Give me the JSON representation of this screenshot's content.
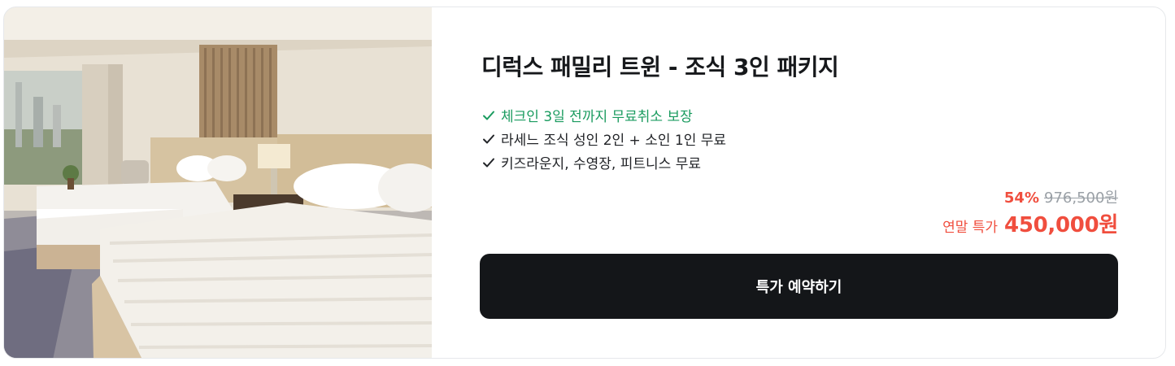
{
  "product": {
    "title": "디럭스 패밀리 트윈 - 조식 3인 패키지",
    "features": [
      {
        "text": "체크인 3일 전까지 무료취소 보장",
        "highlight": true
      },
      {
        "text": "라세느 조식 성인 2인 + 소인 1인 무료",
        "highlight": false
      },
      {
        "text": "키즈라운지, 수영장, 피트니스 무료",
        "highlight": false
      }
    ]
  },
  "price": {
    "discount": "54%",
    "original": "976,500원",
    "sale_label": "연말 특가",
    "sale_price": "450,000원"
  },
  "cta": {
    "label": "특가 예약하기"
  },
  "image": {
    "subject": "hotel-room-twin-beds-photo"
  },
  "icons": {
    "feature_check": "check-icon"
  },
  "colors": {
    "highlight_green": "#1a9b5f",
    "price_red": "#f04e3e",
    "button_bg": "#141619",
    "strike_gray": "#9aa0a6"
  }
}
